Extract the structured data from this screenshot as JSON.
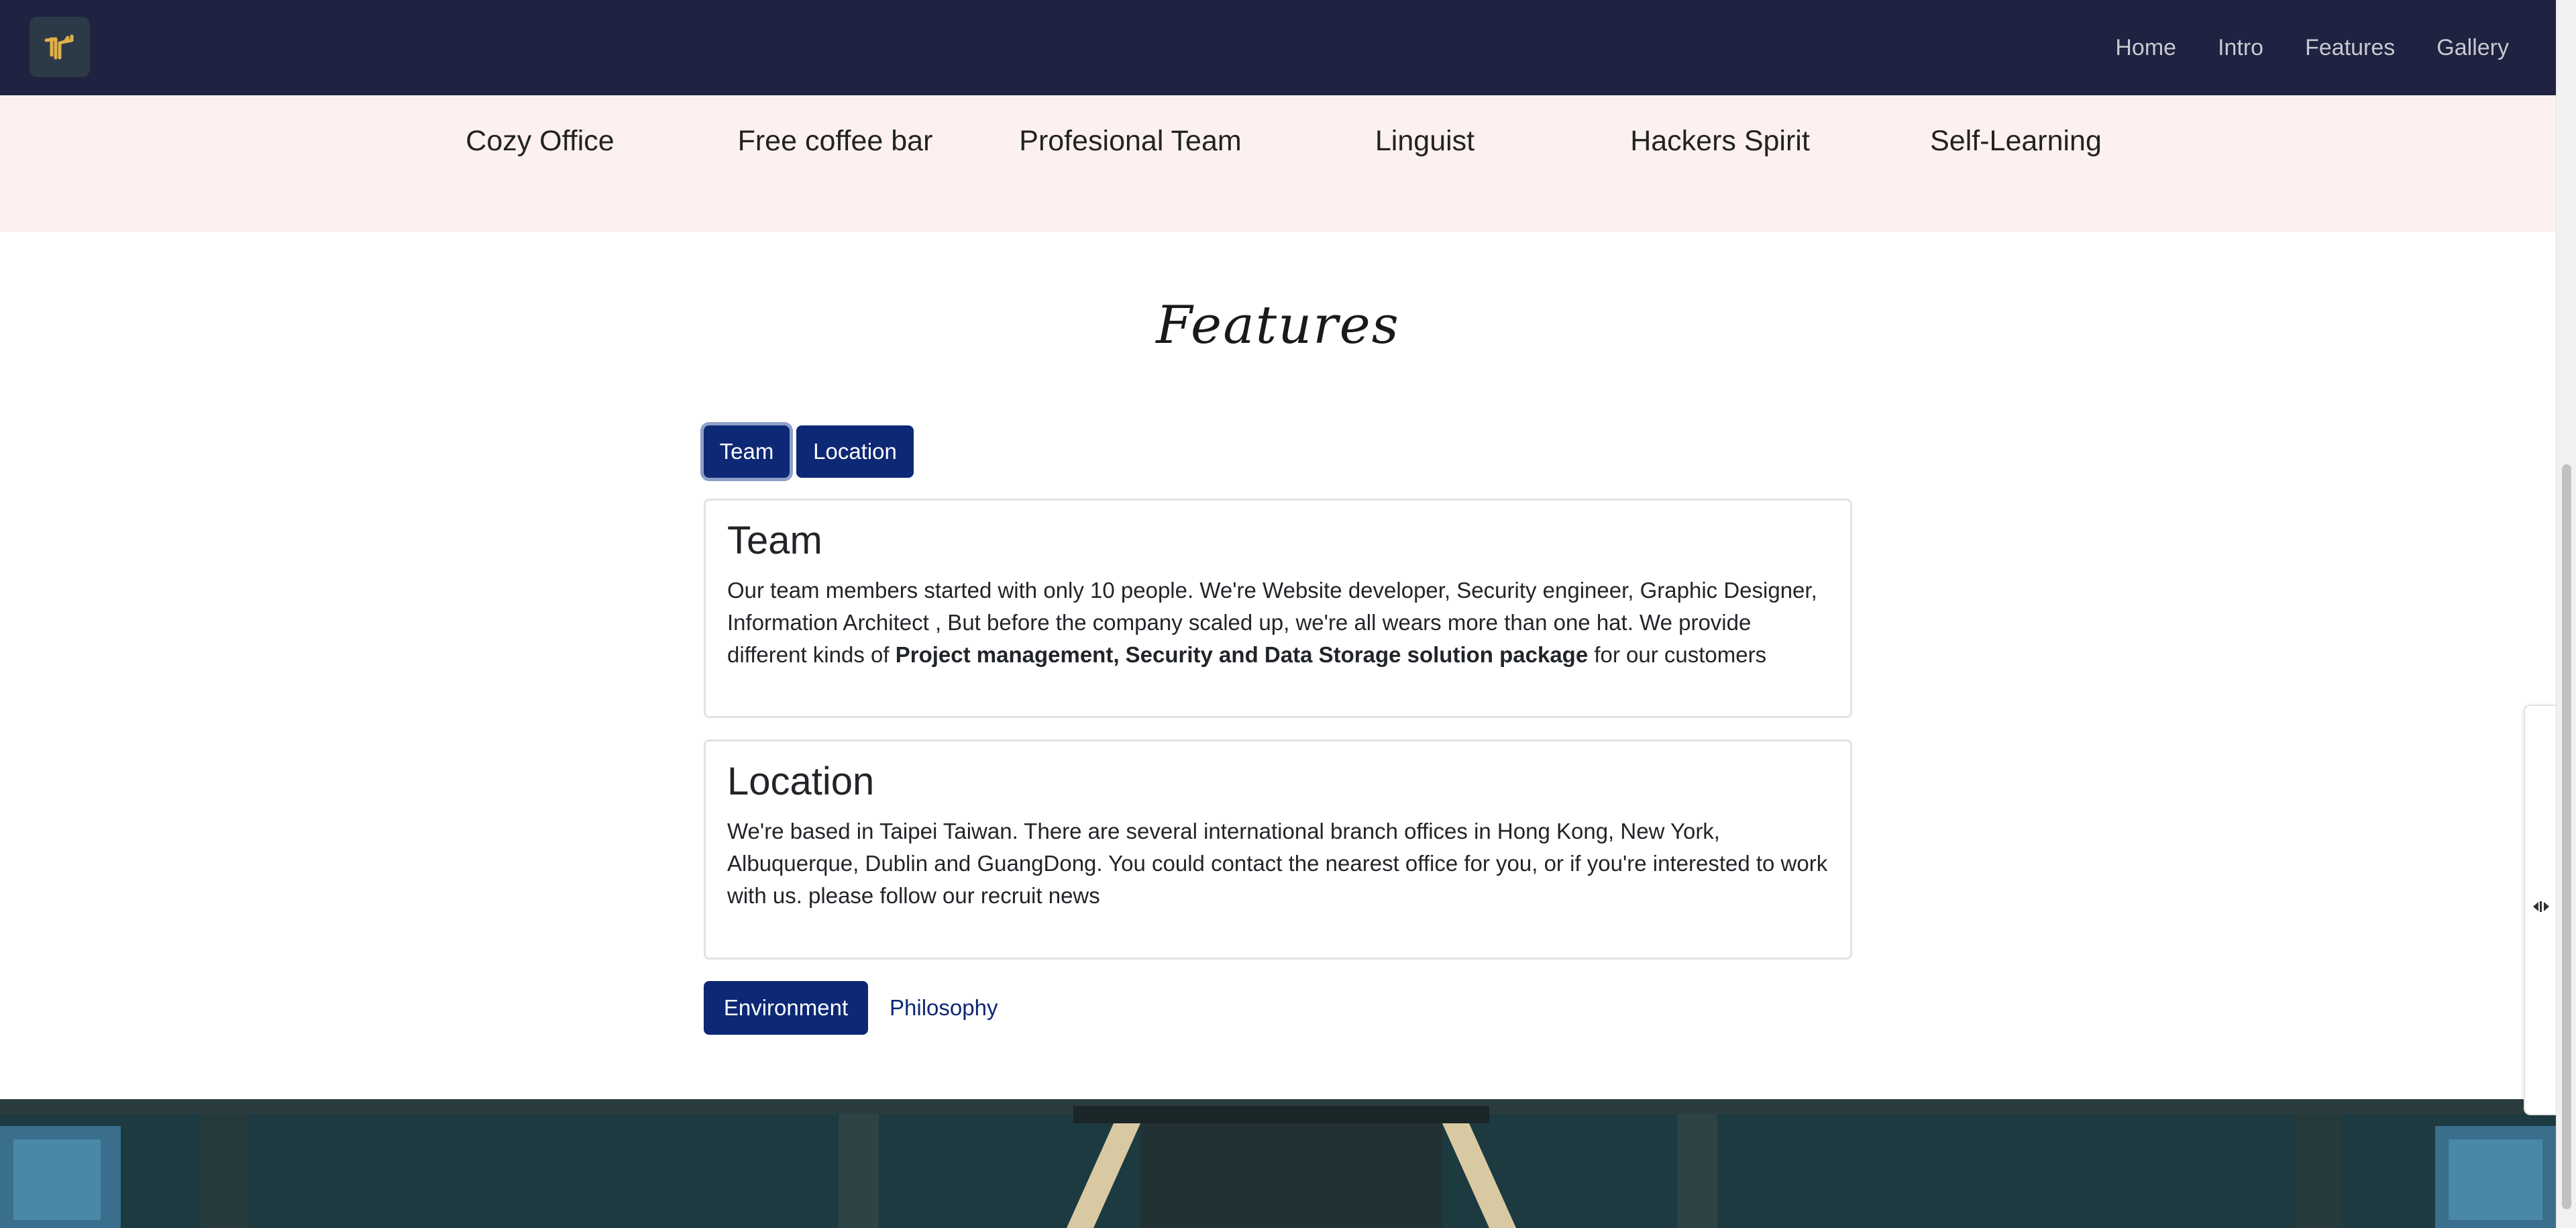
{
  "nav": {
    "logo_alt": "logo-icon",
    "links": [
      "Home",
      "Intro",
      "Features",
      "Gallery"
    ]
  },
  "amenities": [
    {
      "label": "Cozy Office"
    },
    {
      "label": "Free coffee bar"
    },
    {
      "label": "Profesional Team"
    },
    {
      "label": "Linguist"
    },
    {
      "label": "Hackers Spirit"
    },
    {
      "label": "Self-Learning"
    }
  ],
  "features": {
    "title": "Features",
    "tabs": [
      "Team",
      "Location"
    ],
    "team": {
      "heading": "Team",
      "text_before": "Our team members started with only 10 people. We're Website developer, Security engineer, Graphic Designer, Information Architect , But before the company scaled up, we're all wears more than one hat. We provide different kinds of ",
      "text_bold": "Project management, Security and Data Storage solution package",
      "text_after": " for our customers"
    },
    "location": {
      "heading": "Location",
      "text": "We're based in Taipei Taiwan. There are several international branch offices in Hong Kong, New York, Albuquerque, Dublin and GuangDong. You could contact the nearest office for you, or if you're interested to work with us. please follow our recruit news"
    },
    "environment_button": "Environment",
    "philosophy_link": "Philosophy"
  },
  "colors": {
    "navbar": "#1f2240",
    "primary": "#0d2875",
    "amenities_bg": "#fcf1ef"
  }
}
